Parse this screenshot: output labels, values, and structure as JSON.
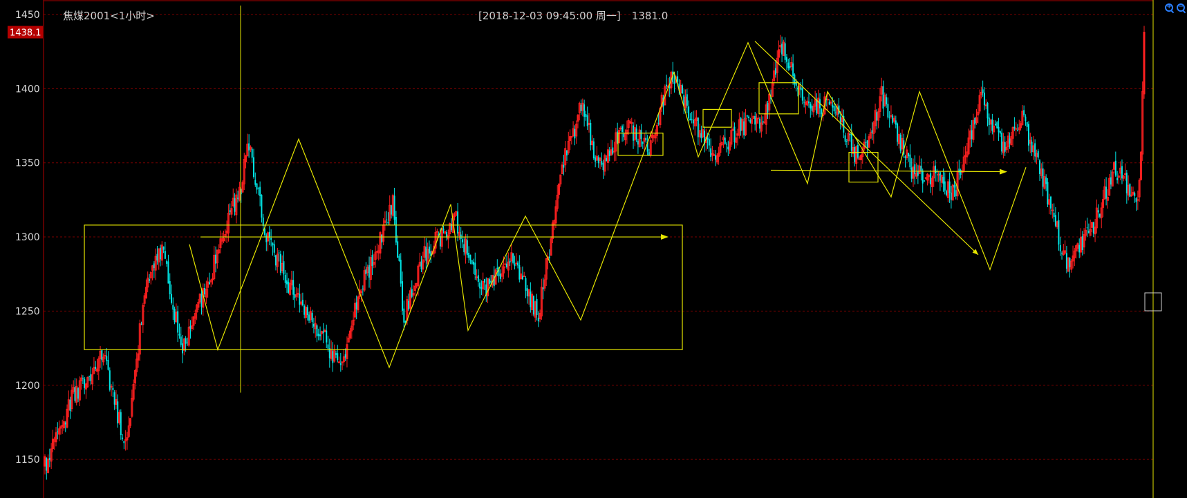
{
  "header": {
    "title": "焦煤2001<1小时>",
    "cursor_datetime": "[2018-12-03  09:45:00 周一]",
    "cursor_value": "1381.0"
  },
  "price_tag": {
    "value": "1438.1"
  },
  "icons": {
    "zoom_in": "zoom-in-icon",
    "zoom_out": "zoom-out-icon"
  },
  "colors": {
    "up": "#ff2020",
    "down": "#00e6e6",
    "drawing": "#e6e600",
    "axis": "#b00000",
    "grid": "#7a0000",
    "crosshair": "#e6e600",
    "tag_bg": "#b40000"
  },
  "chart_data": {
    "type": "candlestick",
    "title": "焦煤2001<1小时>",
    "y_ticks": [
      1150,
      1200,
      1250,
      1300,
      1350,
      1400,
      1450
    ],
    "ylim": [
      1128,
      1462
    ],
    "grid": true,
    "last_price": 1438.1,
    "pivots": [
      [
        0,
        1145
      ],
      [
        17,
        1190
      ],
      [
        37,
        1222
      ],
      [
        51,
        1158
      ],
      [
        64,
        1270
      ],
      [
        75,
        1292
      ],
      [
        86,
        1225
      ],
      [
        100,
        1260
      ],
      [
        124,
        1335
      ],
      [
        128,
        1365
      ],
      [
        140,
        1300
      ],
      [
        156,
        1265
      ],
      [
        172,
        1240
      ],
      [
        187,
        1212
      ],
      [
        200,
        1265
      ],
      [
        220,
        1322
      ],
      [
        227,
        1245
      ],
      [
        241,
        1290
      ],
      [
        260,
        1312
      ],
      [
        275,
        1262
      ],
      [
        295,
        1285
      ],
      [
        312,
        1248
      ],
      [
        328,
        1350
      ],
      [
        340,
        1390
      ],
      [
        350,
        1345
      ],
      [
        368,
        1378
      ],
      [
        381,
        1358
      ],
      [
        396,
        1410
      ],
      [
        410,
        1380
      ],
      [
        424,
        1353
      ],
      [
        437,
        1372
      ],
      [
        455,
        1378
      ],
      [
        466,
        1430
      ],
      [
        481,
        1385
      ],
      [
        497,
        1390
      ],
      [
        515,
        1350
      ],
      [
        529,
        1395
      ],
      [
        548,
        1345
      ],
      [
        564,
        1340
      ],
      [
        575,
        1330
      ],
      [
        592,
        1395
      ],
      [
        606,
        1360
      ],
      [
        618,
        1380
      ],
      [
        632,
        1335
      ],
      [
        646,
        1282
      ],
      [
        662,
        1305
      ],
      [
        676,
        1345
      ],
      [
        691,
        1325
      ],
      [
        693,
        1360
      ],
      [
        695,
        1438
      ]
    ],
    "zigzag": [
      [
        274,
        1295
      ],
      [
        315,
        1224
      ],
      [
        432,
        1366
      ],
      [
        563,
        1212
      ],
      [
        652,
        1322
      ],
      [
        677,
        1237
      ],
      [
        760,
        1314
      ],
      [
        840,
        1244
      ],
      [
        975,
        1411
      ],
      [
        1010,
        1354
      ],
      [
        1082,
        1431
      ],
      [
        1168,
        1336
      ],
      [
        1197,
        1398
      ],
      [
        1289,
        1327
      ],
      [
        1330,
        1398
      ],
      [
        1432,
        1278
      ],
      [
        1484,
        1347
      ]
    ],
    "trend_line": [
      [
        1092,
        1432
      ],
      [
        1415,
        1288
      ]
    ],
    "range_box": {
      "x": [
        122,
        987
      ],
      "y": [
        1224,
        1308
      ]
    },
    "small_boxes": [
      {
        "x": [
          894,
          959
        ],
        "y": [
          1355,
          1370
        ]
      },
      {
        "x": [
          1017,
          1058
        ],
        "y": [
          1374,
          1386
        ]
      },
      {
        "x": [
          1098,
          1155
        ],
        "y": [
          1383,
          1404
        ]
      },
      {
        "x": [
          1228,
          1270
        ],
        "y": [
          1337,
          1357
        ]
      }
    ],
    "arrows": [
      {
        "from": [
          290,
          1300
        ],
        "to": [
          965,
          1300
        ]
      },
      {
        "from": [
          1115,
          1345
        ],
        "to": [
          1455,
          1344
        ]
      }
    ],
    "crosshair": {
      "x": 348,
      "y_top": 1456,
      "y_bottom": 1195
    }
  }
}
